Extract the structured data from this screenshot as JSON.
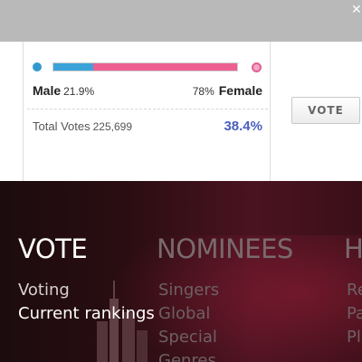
{
  "poll": {
    "male_label": "Male",
    "male_pct": "21.9%",
    "female_label": "Female",
    "female_pct": "78%",
    "male_share": 0.219,
    "total_label": "Total Votes",
    "total_count": "225,699",
    "total_pct": "38.4%",
    "vote_button": "VOTE",
    "colors": {
      "male": "#3ba3d9",
      "female": "#ee5f91",
      "pct": "#4a5fbd"
    }
  },
  "footer": {
    "columns": [
      {
        "heading": "VOTE",
        "links": [
          "Voting",
          "Current rankings"
        ]
      },
      {
        "heading": "NOMINEES",
        "links": [
          "Singers",
          "Global",
          "Special",
          "Genres"
        ]
      },
      {
        "heading": "H",
        "links": [
          "Re",
          "Pa",
          "Pl"
        ]
      }
    ]
  },
  "icons": {
    "top_right": "close-icon",
    "background": "city-skyline"
  }
}
